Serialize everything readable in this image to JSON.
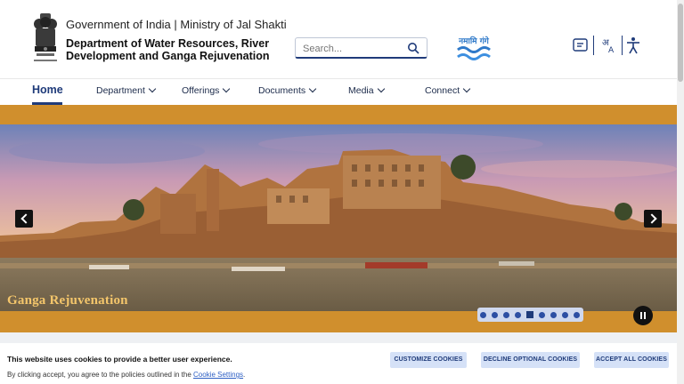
{
  "header": {
    "gov_line": "Government of India | Ministry of Jal Shakti",
    "dept_title": "Department of Water Resources, River Development and Ganga Rejuvenation",
    "search_placeholder": "Search...",
    "namami_logo_text": "नमामि गंगे"
  },
  "nav": {
    "home": "Home",
    "items": [
      {
        "label": "Department"
      },
      {
        "label": "Offerings"
      },
      {
        "label": "Documents"
      },
      {
        "label": "Media"
      },
      {
        "label": "Connect"
      }
    ]
  },
  "hero": {
    "caption": "Ganga Rejuvenation",
    "slide_count": 9,
    "active_slide": 5
  },
  "cookie": {
    "title": "This website uses cookies to provide a better user experience.",
    "text_before": "By clicking accept, you agree to the policies outlined in the ",
    "link_text": "Cookie Settings",
    "text_after": ".",
    "customize": "CUSTOMIZE COOKIES",
    "decline": "DECLINE OPTIONAL COOKIES",
    "accept": "ACCEPT ALL COOKIES"
  },
  "colors": {
    "brand_blue": "#1f3b7a",
    "saffron_band": "#d08f2d",
    "button_bg": "#d5e1f7"
  }
}
